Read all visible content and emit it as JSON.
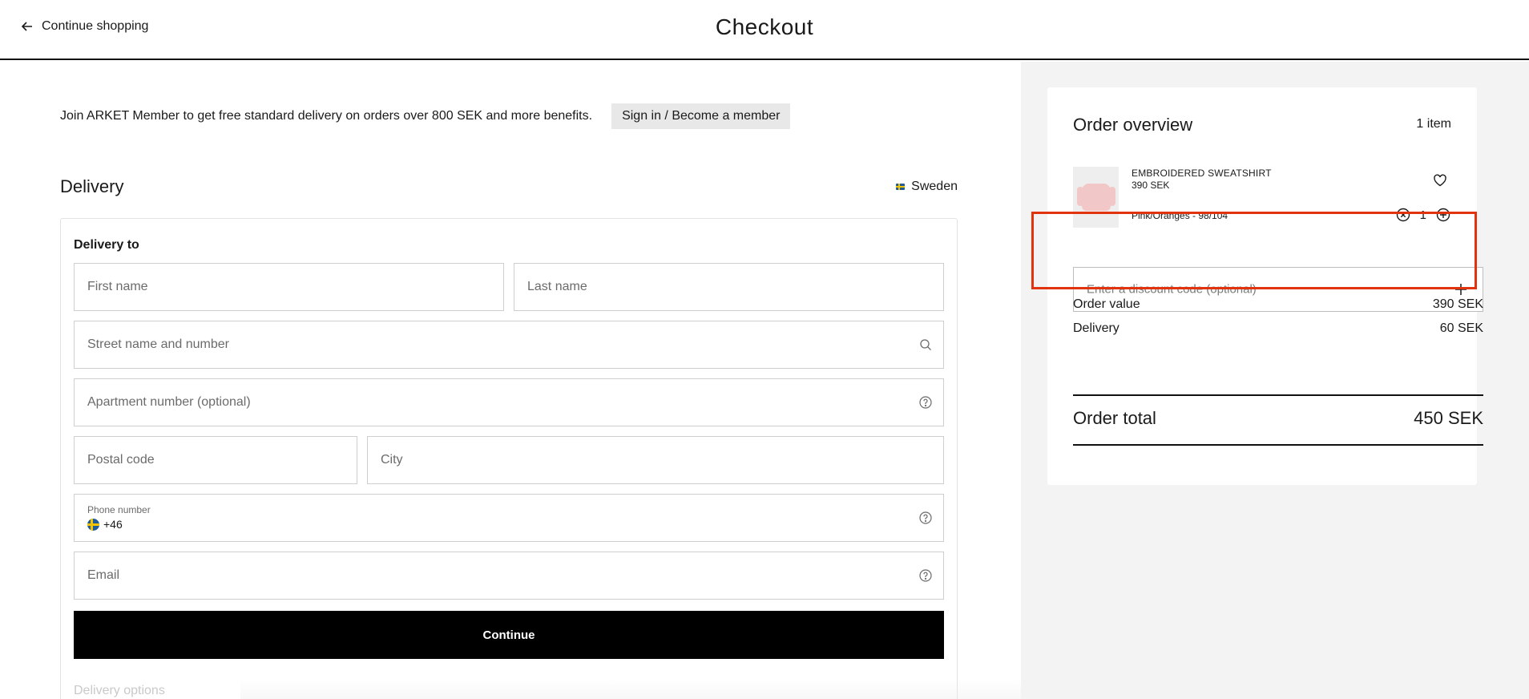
{
  "header": {
    "back_label": "Continue shopping",
    "title": "Checkout"
  },
  "promo": {
    "text": "Join ARKET Member to get free standard delivery on orders over 800 SEK and more benefits.",
    "button_label": "Sign in / Become a member"
  },
  "delivery": {
    "title": "Delivery",
    "country": "Sweden",
    "section_label": "Delivery to",
    "fields": {
      "first_name": "First name",
      "last_name": "Last name",
      "street": "Street name and number",
      "apartment": "Apartment number (optional)",
      "postal_code": "Postal code",
      "city": "City",
      "phone_label": "Phone number",
      "phone_prefix": "+46",
      "email": "Email"
    },
    "continue_label": "Continue",
    "next_section": "Delivery options"
  },
  "order": {
    "title": "Order overview",
    "item_count": "1 item",
    "product": {
      "name": "EMBROIDERED SWEATSHIRT",
      "price": "390 SEK",
      "variant": "Pink/Oranges - 98/104",
      "quantity": "1"
    },
    "discount_placeholder": "Enter a discount code (optional)",
    "order_value_label": "Order value",
    "order_value": "390 SEK",
    "delivery_label": "Delivery",
    "delivery_value": "60 SEK",
    "total_label": "Order total",
    "total_value": "450 SEK"
  },
  "colors": {
    "highlight": "#e0330e",
    "primary_button": "#000000",
    "sidebar_bg": "#f3f3f3"
  },
  "icons": {
    "back": "arrow-left-icon",
    "search": "search-icon",
    "help": "help-circle-icon",
    "favorite": "heart-icon",
    "remove": "remove-circle-icon",
    "add": "plus-circle-icon",
    "discount_add": "plus-icon"
  }
}
